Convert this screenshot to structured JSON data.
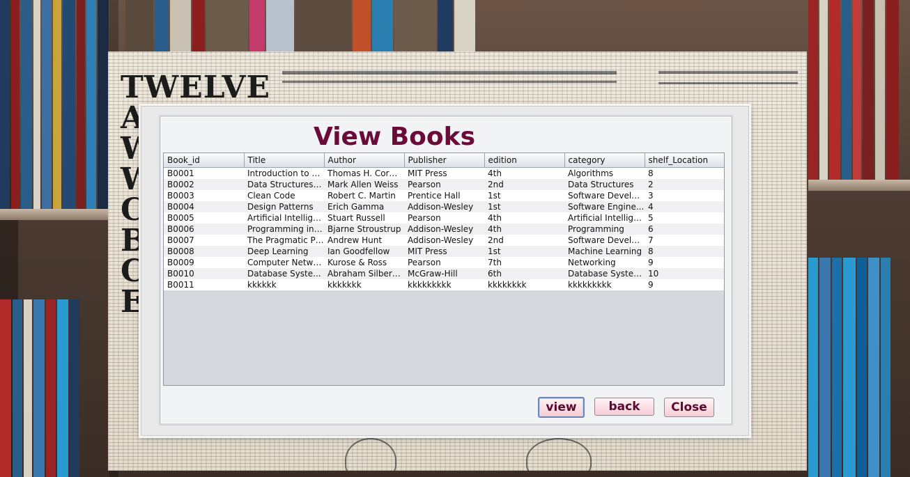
{
  "window": {
    "title": "View Books"
  },
  "table": {
    "columns": [
      "Book_id",
      "Title",
      "Author",
      "Publisher",
      "edition",
      "category",
      "shelf_Location"
    ],
    "rows": [
      [
        "B0001",
        "Introduction to Al...",
        "Thomas H. Corm...",
        "MIT Press",
        "4th",
        "Algorithms",
        "8"
      ],
      [
        "B0002",
        "Data Structures a...",
        "Mark Allen Weiss",
        "Pearson",
        "2nd",
        "Data Structures",
        "2"
      ],
      [
        "B0003",
        "Clean Code",
        "Robert C. Martin",
        "Prentice Hall",
        "1st",
        "Software Develop...",
        "3"
      ],
      [
        "B0004",
        "Design Patterns",
        "Erich Gamma",
        "Addison-Wesley",
        "1st",
        "Software Engine...",
        "4"
      ],
      [
        "B0005",
        "Artificial Intelligen...",
        "Stuart Russell",
        "Pearson",
        "4th",
        "Artificial Intelligen...",
        "5"
      ],
      [
        "B0006",
        "Programming in ...",
        "Bjarne Stroustrup",
        "Addison-Wesley",
        "4th",
        "Programming",
        "6"
      ],
      [
        "B0007",
        "The Pragmatic Pr...",
        "Andrew Hunt",
        "Addison-Wesley",
        "2nd",
        "Software Develop...",
        "7"
      ],
      [
        "B0008",
        "Deep Learning",
        "Ian Goodfellow",
        "MIT Press",
        "1st",
        "Machine Learning",
        "8"
      ],
      [
        "B0009",
        "Computer Netwo...",
        "Kurose & Ross",
        "Pearson",
        "7th",
        "Networking",
        "9"
      ],
      [
        "B0010",
        "Database Syste...",
        "Abraham Silbers...",
        "McGraw-Hill",
        "6th",
        "Database Systems",
        "10"
      ],
      [
        "B0011",
        "kkkkkk",
        "kkkkkkk",
        "kkkkkkkkk",
        "kkkkkkkk",
        "kkkkkkkkk",
        "9"
      ]
    ]
  },
  "buttons": {
    "view": "view",
    "back": "back",
    "close": "Close"
  },
  "background": {
    "headline": "TWELVE AMERICAN WI WI CO BU CH E"
  },
  "colors": {
    "title": "#6b0b3a",
    "button_text": "#5a0a2e",
    "button_bg": "#f6ccd4"
  }
}
